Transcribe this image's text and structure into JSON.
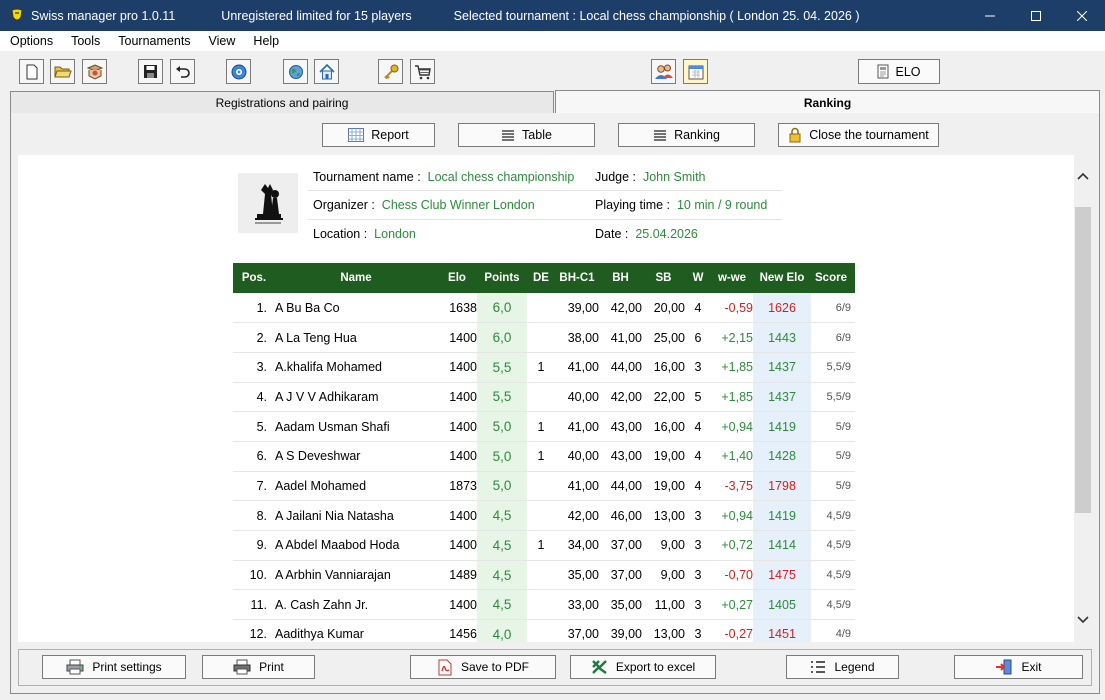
{
  "window": {
    "app_title": "Swiss manager pro  1.0.11",
    "license": "Unregistered limited for 15 players",
    "selected": "Selected tournament : Local chess championship  ( London 25. 04. 2026 )"
  },
  "menu": [
    "Options",
    "Tools",
    "Tournaments",
    "View",
    "Help"
  ],
  "toolbar": {
    "elo_label": "ELO"
  },
  "tabs": {
    "registrations": "Registrations and pairing",
    "ranking": "Ranking"
  },
  "actions": {
    "report": "Report",
    "table": "Table",
    "ranking": "Ranking",
    "close": "Close the tournament"
  },
  "info": {
    "name_label": "Tournament name :",
    "name_value": "Local chess championship",
    "judge_label": "Judge :",
    "judge_value": "John Smith",
    "org_label": "Organizer :",
    "org_value": "Chess Club Winner London",
    "time_label": "Playing time :",
    "time_value": "10 min / 9 round",
    "loc_label": "Location :",
    "loc_value": "London",
    "date_label": "Date :",
    "date_value": "25.04.2026"
  },
  "table": {
    "headers": [
      "Pos.",
      "Name",
      "Elo",
      "Points",
      "DE",
      "BH-C1",
      "BH",
      "SB",
      "W",
      "w-we",
      "New Elo",
      "Score"
    ],
    "rows": [
      {
        "pos": "1.",
        "name": "A Bu Ba Co",
        "elo": "1638",
        "pts": "6,0",
        "de": "",
        "bh1": "39,00",
        "bh": "42,00",
        "sb": "20,00",
        "w": "4",
        "wwe": "-0,59",
        "new": "1626",
        "score": "6/9"
      },
      {
        "pos": "2.",
        "name": "A La Teng Hua",
        "elo": "1400",
        "pts": "6,0",
        "de": "",
        "bh1": "38,00",
        "bh": "41,00",
        "sb": "25,00",
        "w": "6",
        "wwe": "+2,15",
        "new": "1443",
        "score": "6/9"
      },
      {
        "pos": "3.",
        "name": "A.khalifa Mohamed",
        "elo": "1400",
        "pts": "5,5",
        "de": "1",
        "bh1": "41,00",
        "bh": "44,00",
        "sb": "16,00",
        "w": "3",
        "wwe": "+1,85",
        "new": "1437",
        "score": "5,5/9"
      },
      {
        "pos": "4.",
        "name": "A J V V Adhikaram",
        "elo": "1400",
        "pts": "5,5",
        "de": "",
        "bh1": "40,00",
        "bh": "42,00",
        "sb": "22,00",
        "w": "5",
        "wwe": "+1,85",
        "new": "1437",
        "score": "5,5/9"
      },
      {
        "pos": "5.",
        "name": "Aadam Usman Shafi",
        "elo": "1400",
        "pts": "5,0",
        "de": "1",
        "bh1": "41,00",
        "bh": "43,00",
        "sb": "16,00",
        "w": "4",
        "wwe": "+0,94",
        "new": "1419",
        "score": "5/9"
      },
      {
        "pos": "6.",
        "name": "A S Deveshwar",
        "elo": "1400",
        "pts": "5,0",
        "de": "1",
        "bh1": "40,00",
        "bh": "43,00",
        "sb": "19,00",
        "w": "4",
        "wwe": "+1,40",
        "new": "1428",
        "score": "5/9"
      },
      {
        "pos": "7.",
        "name": "Aadel Mohamed",
        "elo": "1873",
        "pts": "5,0",
        "de": "",
        "bh1": "41,00",
        "bh": "44,00",
        "sb": "19,00",
        "w": "4",
        "wwe": "-3,75",
        "new": "1798",
        "score": "5/9"
      },
      {
        "pos": "8.",
        "name": "A Jailani Nia Natasha",
        "elo": "1400",
        "pts": "4,5",
        "de": "",
        "bh1": "42,00",
        "bh": "46,00",
        "sb": "13,00",
        "w": "3",
        "wwe": "+0,94",
        "new": "1419",
        "score": "4,5/9"
      },
      {
        "pos": "9.",
        "name": "A Abdel Maabod Hoda",
        "elo": "1400",
        "pts": "4,5",
        "de": "1",
        "bh1": "34,00",
        "bh": "37,00",
        "sb": "9,00",
        "w": "3",
        "wwe": "+0,72",
        "new": "1414",
        "score": "4,5/9"
      },
      {
        "pos": "10.",
        "name": "A Arbhin Vanniarajan",
        "elo": "1489",
        "pts": "4,5",
        "de": "",
        "bh1": "35,00",
        "bh": "37,00",
        "sb": "9,00",
        "w": "3",
        "wwe": "-0,70",
        "new": "1475",
        "score": "4,5/9"
      },
      {
        "pos": "11.",
        "name": "A. Cash Zahn Jr.",
        "elo": "1400",
        "pts": "4,5",
        "de": "",
        "bh1": "33,00",
        "bh": "35,00",
        "sb": "11,00",
        "w": "3",
        "wwe": "+0,27",
        "new": "1405",
        "score": "4,5/9"
      },
      {
        "pos": "12.",
        "name": "Aadithya Kumar",
        "elo": "1456",
        "pts": "4,0",
        "de": "",
        "bh1": "37,00",
        "bh": "39,00",
        "sb": "13,00",
        "w": "3",
        "wwe": "-0,27",
        "new": "1451",
        "score": "4/9"
      }
    ]
  },
  "bottom": {
    "print_settings": "Print settings",
    "print": "Print",
    "pdf": "Save to PDF",
    "excel": "Export to excel",
    "legend": "Legend",
    "exit": "Exit"
  },
  "colors": {
    "titlebar": "#1e3e6a",
    "table_header": "#1f5c1f",
    "positive": "#2e8b3c",
    "negative": "#d42020"
  }
}
